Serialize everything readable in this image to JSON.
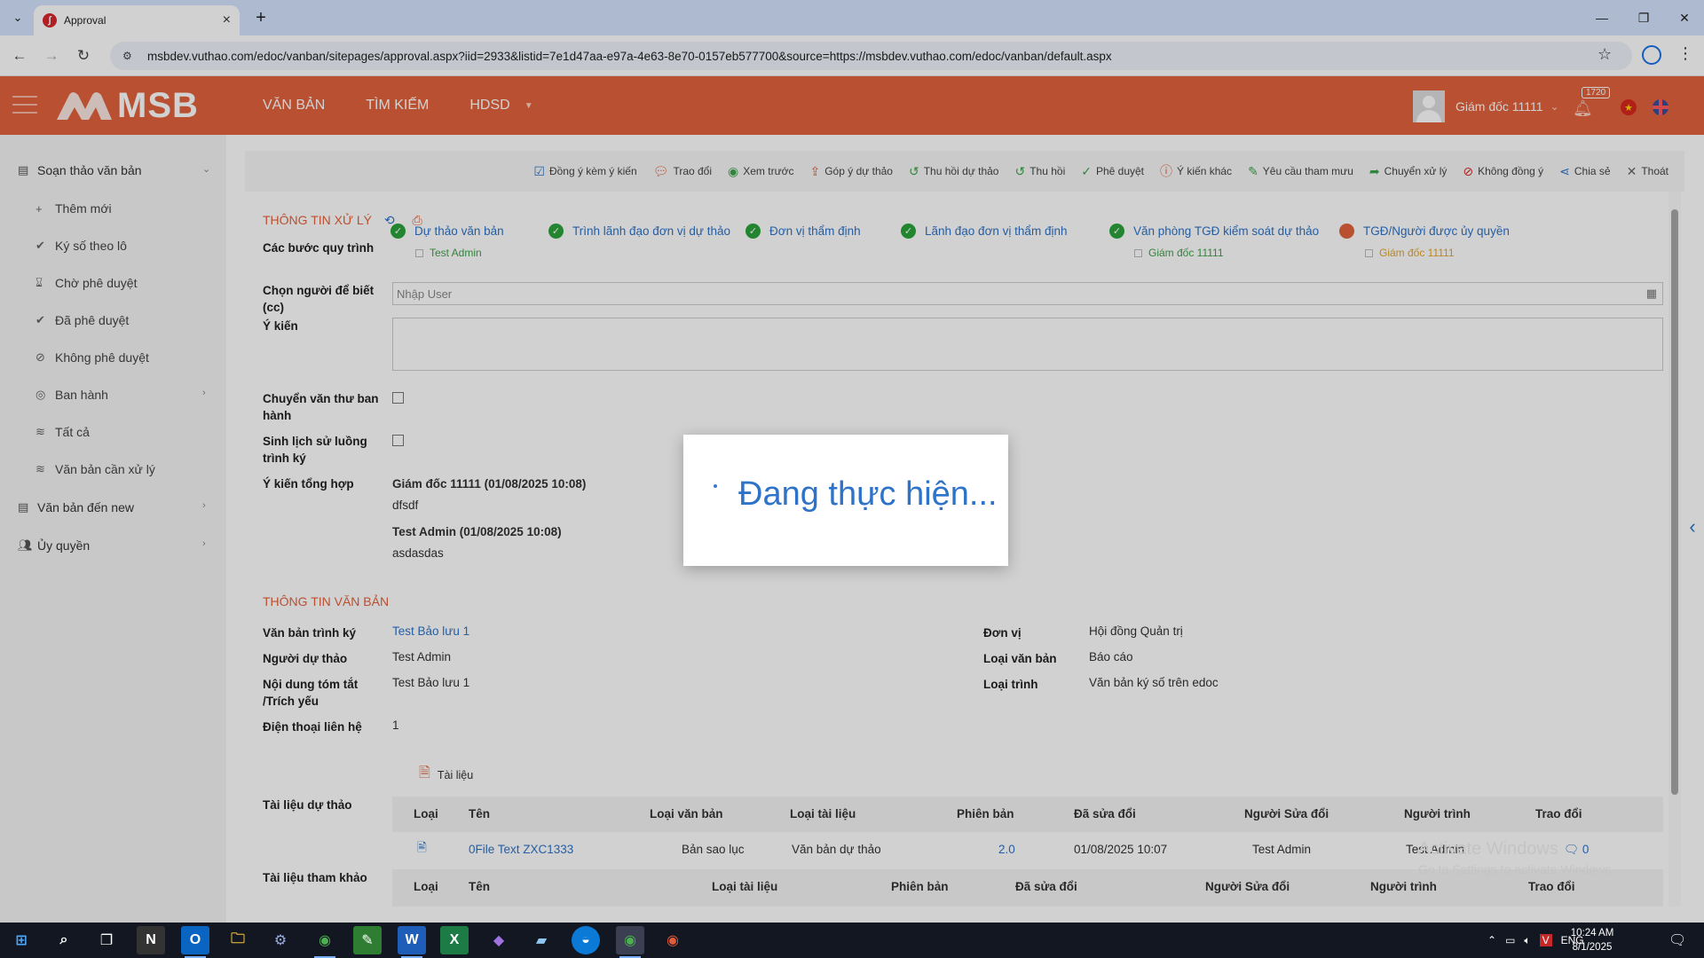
{
  "browser": {
    "tab_title": "Approval",
    "url": "msbdev.vuthao.com/edoc/vanban/sitepages/approval.aspx?iid=2933&listid=7e1d47aa-e97a-4e63-8e70-0157eb577700&source=https://msbdev.vuthao.com/edoc/vanban/default.aspx"
  },
  "header": {
    "logo": "MSB",
    "nav": [
      "VĂN BẢN",
      "TÌM KIẾM",
      "HDSD"
    ],
    "user_name": "Giám đốc 11111",
    "notif_count": "1720"
  },
  "sidebar": {
    "group1": "Soạn thảo văn bản",
    "items": [
      "Thêm mới",
      "Ký số theo lô",
      "Chờ phê duyệt",
      "Đã phê duyệt",
      "Không phê duyệt",
      "Ban hành",
      "Tất cả",
      "Văn bản cần xử lý"
    ],
    "group2": "Văn bản đến new",
    "group3": "Ủy quyền"
  },
  "toolbar": [
    "Đồng ý kèm ý kiến",
    "Trao đổi",
    "Xem trước",
    "Góp ý dự thảo",
    "Thu hồi dự thảo",
    "Thu hồi",
    "Phê duyệt",
    "Ý kiến khác",
    "Yêu cầu tham mưu",
    "Chuyển xử lý",
    "Không đồng ý",
    "Chia sẻ",
    "Thoát"
  ],
  "processing": {
    "title": "THÔNG TIN XỬ LÝ",
    "steps_label": "Các bước quy trình",
    "steps": [
      {
        "label": "Dự thảo văn bản",
        "sub": "Test Admin"
      },
      {
        "label": "Trình lãnh đạo đơn vị dự thảo",
        "sub": ""
      },
      {
        "label": "Đơn vị thẩm định",
        "sub": ""
      },
      {
        "label": "Lãnh đạo đơn vị thẩm định",
        "sub": ""
      },
      {
        "label": "Văn phòng TGĐ kiểm soát dự thảo",
        "sub": "Giám đốc 11111"
      },
      {
        "label": "TGĐ/Người được ủy quyền",
        "sub": "Giám đốc 11111"
      }
    ],
    "cc_label": "Chọn người để biết (cc)",
    "cc_placeholder": "Nhập User",
    "opinion_label": "Ý kiến",
    "transfer_label": "Chuyển văn thư ban hành",
    "history_label": "Sinh lịch sử luồng trình ký",
    "summary_label": "Ý kiến tổng hợp",
    "comments": [
      {
        "author": "Giám đốc 11111 (01/08/2025 10:08)",
        "text": "dfsdf"
      },
      {
        "author": "Test Admin (01/08/2025 10:08)",
        "text": "asdasdas"
      }
    ]
  },
  "document": {
    "title": "THÔNG TIN VĂN BẢN",
    "fields_left": [
      {
        "label": "Văn bản trình ký",
        "value": "Test Bảo lưu 1"
      },
      {
        "label": "Người dự thảo",
        "value": "Test Admin"
      },
      {
        "label": "Nội dung tóm tắt /Trích yếu",
        "value": "Test Bảo lưu 1"
      },
      {
        "label": "Điện thoại liên hệ",
        "value": "1"
      }
    ],
    "fields_right": [
      {
        "label": "Đơn vị",
        "value": "Hội đồng Quản trị"
      },
      {
        "label": "Loại văn bản",
        "value": "Báo cáo"
      },
      {
        "label": "Loại trình",
        "value": "Văn bản ký số trên edoc"
      }
    ],
    "attach_label": "Tài liệu",
    "draft_label": "Tài liệu dự thảo",
    "draft_cols": [
      "Loại",
      "Tên",
      "Loại văn bản",
      "Loại tài liệu",
      "Phiên bản",
      "Đã sửa đổi",
      "Người Sửa đổi",
      "Người trình",
      "Trao đổi"
    ],
    "draft_row": {
      "name": "0File Text ZXC1333",
      "doc_type": "Bản sao lục",
      "file_type": "Văn bản dự thảo",
      "version": "2.0",
      "modified": "01/08/2025 10:07",
      "editor": "Test Admin",
      "submitter": "Test Admin",
      "comments": "0"
    },
    "ref_label": "Tài liệu tham khảo",
    "ref_cols": [
      "Loại",
      "Tên",
      "Loại tài liệu",
      "Phiên bản",
      "Đã sửa đổi",
      "Người Sửa đổi",
      "Người trình",
      "Trao đổi"
    ]
  },
  "modal": {
    "text": "Đang thực hiện..."
  },
  "watermark": {
    "line1": "Activate Windows",
    "line2": "Go to Settings to activate Windows."
  },
  "taskbar": {
    "lang": "ENG",
    "time": "10:24 AM",
    "date": "8/1/2025"
  }
}
